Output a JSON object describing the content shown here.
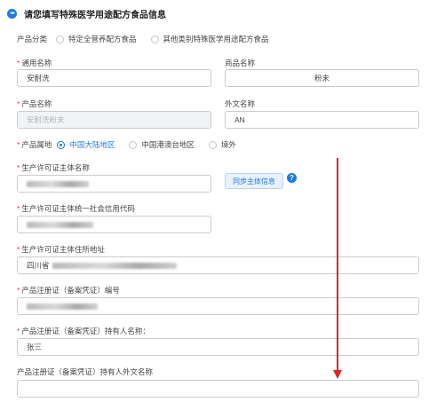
{
  "section": {
    "title": "请您填写特殊医学用途配方食品信息"
  },
  "product_category": {
    "label": "产品分类",
    "options": [
      "特定全营养配方食品",
      "其他类别特殊医学用途配方食品"
    ]
  },
  "common_name": {
    "label": "通用名称",
    "value": "安耐洗"
  },
  "trade_name": {
    "label": "商品名称",
    "value": "粉末"
  },
  "product_name": {
    "label": "产品名称",
    "value": "安耐洗粉末"
  },
  "foreign_name": {
    "label": "外文名称",
    "value": "AN"
  },
  "origin": {
    "label": "产品属地",
    "options": [
      "中国大陆地区",
      "中国港澳台地区",
      "境外"
    ]
  },
  "licensee_name": {
    "label": "生产许可证主体名称"
  },
  "sync_button": {
    "label": "同步主体信息"
  },
  "help_icon": {
    "glyph": "?"
  },
  "credit_code": {
    "label": "生产许可证主体统一社会信用代码"
  },
  "address": {
    "label": "生产许可证主体住所地址",
    "value_prefix": "四川省"
  },
  "reg_number": {
    "label": "产品注册证（备案凭证）编号"
  },
  "holder_name": {
    "label": "产品注册证（备案凭证）持有人名称：",
    "value": "张三"
  },
  "holder_foreign_name": {
    "label": "产品注册证（备案凭证）持有人外文名称",
    "value": ""
  },
  "colors": {
    "accent": "#1f7ae0",
    "required": "#e4393c",
    "annotation_arrow": "#e0242b"
  }
}
